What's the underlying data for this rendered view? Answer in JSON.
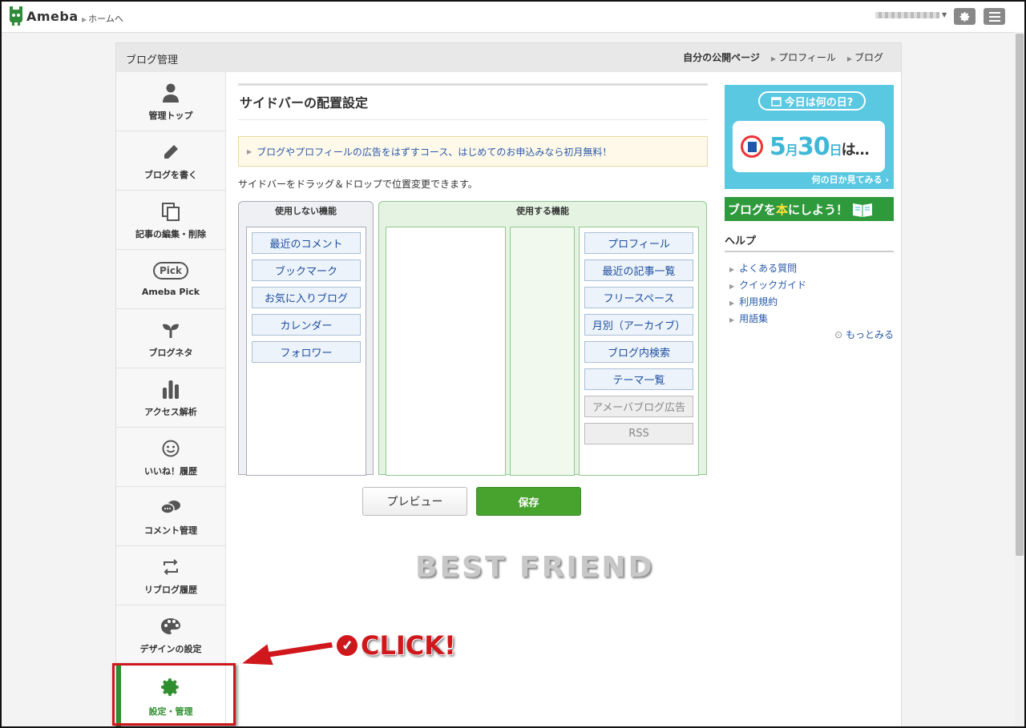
{
  "header": {
    "logo_text": "Ameba",
    "home_link": "ホームへ"
  },
  "panel": {
    "title": "ブログ管理",
    "links": [
      "自分の公開ページ",
      "プロフィール",
      "ブログ"
    ]
  },
  "sidebar": {
    "items": [
      {
        "label": "管理トップ",
        "icon": "person-icon"
      },
      {
        "label": "ブログを書く",
        "icon": "pencil-icon"
      },
      {
        "label": "記事の編集・削除",
        "icon": "documents-icon"
      },
      {
        "label": "Ameba Pick",
        "icon": "pick-icon",
        "icon_text": "Pick"
      },
      {
        "label": "ブログネタ",
        "icon": "sprout-icon"
      },
      {
        "label": "アクセス解析",
        "icon": "bar-chart-icon"
      },
      {
        "label": "いいね！履歴",
        "icon": "smiley-icon"
      },
      {
        "label": "コメント管理",
        "icon": "speech-bubbles-icon"
      },
      {
        "label": "リブログ履歴",
        "icon": "reblog-icon"
      },
      {
        "label": "デザインの設定",
        "icon": "palette-icon"
      },
      {
        "label": "設定・管理",
        "icon": "gear-icon",
        "active": true
      }
    ]
  },
  "content": {
    "title": "サイドバーの配置設定",
    "notice": "ブログやプロフィールの広告をはずすコース、はじめてのお申込みなら初月無料！",
    "instruction": "サイドバーをドラッグ＆ドロップで位置変更できます。",
    "unused_title": "使用しない機能",
    "used_title": "使用する機能",
    "unused_widgets": [
      "最近のコメント",
      "ブックマーク",
      "お気に入りブログ",
      "カレンダー",
      "フォロワー"
    ],
    "used_widgets": [
      "プロフィール",
      "最近の記事一覧",
      "フリースペース",
      "月別（アーカイブ）",
      "ブログ内検索",
      "テーマ一覧"
    ],
    "fixed_widgets": [
      "アメーバブログ広告",
      "RSS"
    ],
    "preview_button": "プレビュー",
    "save_button": "保存"
  },
  "right": {
    "today_pill": "今日は何の日?",
    "date_month": "5",
    "date_month_unit": "月",
    "date_day": "30",
    "date_day_unit": "日",
    "date_suffix": "は…",
    "today_more": "何の日か見てみる",
    "book_banner_pre": "ブログを",
    "book_banner_hl": "本",
    "book_banner_post": "にしよう！",
    "help_title": "ヘルプ",
    "help_links": [
      "よくある質問",
      "クイックガイド",
      "利用規約",
      "用語集"
    ],
    "more": "もっとみる"
  },
  "overlay": {
    "watermark": "BEST FRIEND",
    "click_text": "CLICK!"
  },
  "colors": {
    "accent_green": "#48a22e",
    "highlight_red": "#d0171c",
    "link_blue": "#2a5aa8"
  }
}
